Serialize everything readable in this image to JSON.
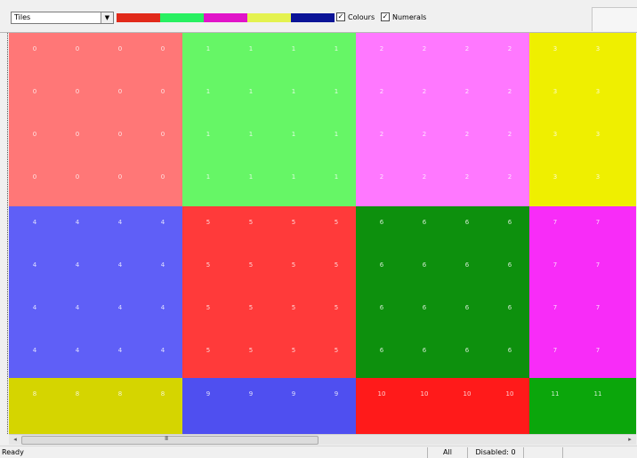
{
  "toolbar": {
    "mode_select_value": "Tiles",
    "palette": [
      "#e12a1a",
      "#28f061",
      "#e114c9",
      "#e4f24f",
      "#0b1497"
    ],
    "colours_checkbox": {
      "label": "Colours",
      "checked": true
    },
    "numerals_checkbox": {
      "label": "Numerals",
      "checked": true
    }
  },
  "canvas": {
    "tile_colors": [
      "#ff7777",
      "#66f666",
      "#ff78ff",
      "#efef00",
      "#5f5ff7",
      "#ff3a3a",
      "#0d900d",
      "#f82cf8",
      "#d5d500",
      "#4f4ff0",
      "#ff1a1a",
      "#0ba60b"
    ],
    "tile_labels": [
      "0",
      "1",
      "2",
      "3",
      "4",
      "5",
      "6",
      "7",
      "8",
      "9",
      "10",
      "11"
    ]
  },
  "status_bar": {
    "status": "Ready",
    "filter": "All",
    "disabled": "Disabled: 0"
  },
  "scrollbar": {
    "left_arrow": "◂",
    "right_arrow": "▸",
    "thumb_grip": "III"
  }
}
